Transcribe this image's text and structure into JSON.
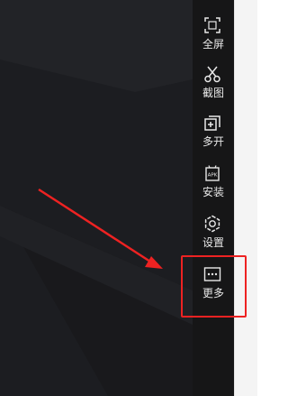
{
  "toolbar": {
    "items": [
      {
        "label": "全屏",
        "icon": "fullscreen-icon"
      },
      {
        "label": "截图",
        "icon": "scissors-icon"
      },
      {
        "label": "多开",
        "icon": "multi-open-icon"
      },
      {
        "label": "安装",
        "icon": "apk-install-icon"
      },
      {
        "label": "设置",
        "icon": "gear-icon"
      },
      {
        "label": "更多",
        "icon": "more-icon"
      }
    ]
  },
  "annotation": {
    "highlight_color": "#ee2222",
    "arrow_color": "#ee2222",
    "highlighted_item": "更多"
  }
}
